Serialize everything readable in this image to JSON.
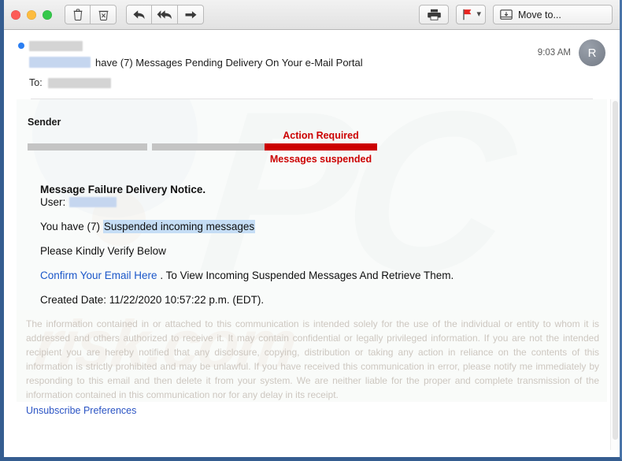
{
  "window": {
    "accent_blue": "#355d90",
    "traffic_lights": [
      "close",
      "minimize",
      "zoom"
    ]
  },
  "toolbar": {
    "delete_label": "Delete",
    "junk_label": "Junk",
    "reply_label": "Reply",
    "reply_all_label": "Reply All",
    "forward_label": "Forward",
    "print_label": "Print",
    "flag_label": "Flag",
    "flag_color": "#e8231f",
    "flag_dropdown_label": "⌄",
    "move_to_label": "Move to..."
  },
  "message_header": {
    "sender_redacted": "",
    "subject_prefix_redacted": "",
    "subject": "have (7) Messages Pending Delivery On Your e-Mail Portal",
    "to_label": "To:",
    "to_redacted": "",
    "time": "9:03 AM",
    "avatar_initial": "R"
  },
  "banner": {
    "sender_label": "Sender",
    "action_required": "Action Required",
    "messages_suspended": "Messages suspended",
    "red": "#cc0000",
    "gray": "#c4c4c4"
  },
  "body": {
    "title": "Message Failure Delivery Notice.",
    "user_label": "User:",
    "user_redacted": "",
    "count_text_before": "You have (7) ",
    "count_text_highlight": "Suspended incoming messages",
    "verify_text": "Please Kindly Verify Below",
    "link_text": "Confirm Your Email Here",
    "link_suffix": " . To View Incoming Suspended Messages And Retrieve Them.",
    "created_date": "Created Date: 11/22/2020 10:57:22 p.m. (EDT)."
  },
  "disclaimer": {
    "text": "The information contained in or attached to this communication is intended solely for the use of the individual or entity to whom it is addressed and others authorized to receive it.  It may contain confidential or legally privileged information. If you are not the intended recipient you are hereby notified that any disclosure, copying, distribution or taking any action in reliance on the contents of this information is strictly prohibited and may be unlawful.  If you have received this communication in error, please notify me immediately by responding to this email and then delete it from your system. We are neither liable for the proper and complete transmission of the information contained in this communication nor for any delay in its receipt.",
    "unsubscribe_label": "Unsubscribe Preferences"
  },
  "watermark": {
    "mark": "PC",
    "word": "risk.com"
  }
}
